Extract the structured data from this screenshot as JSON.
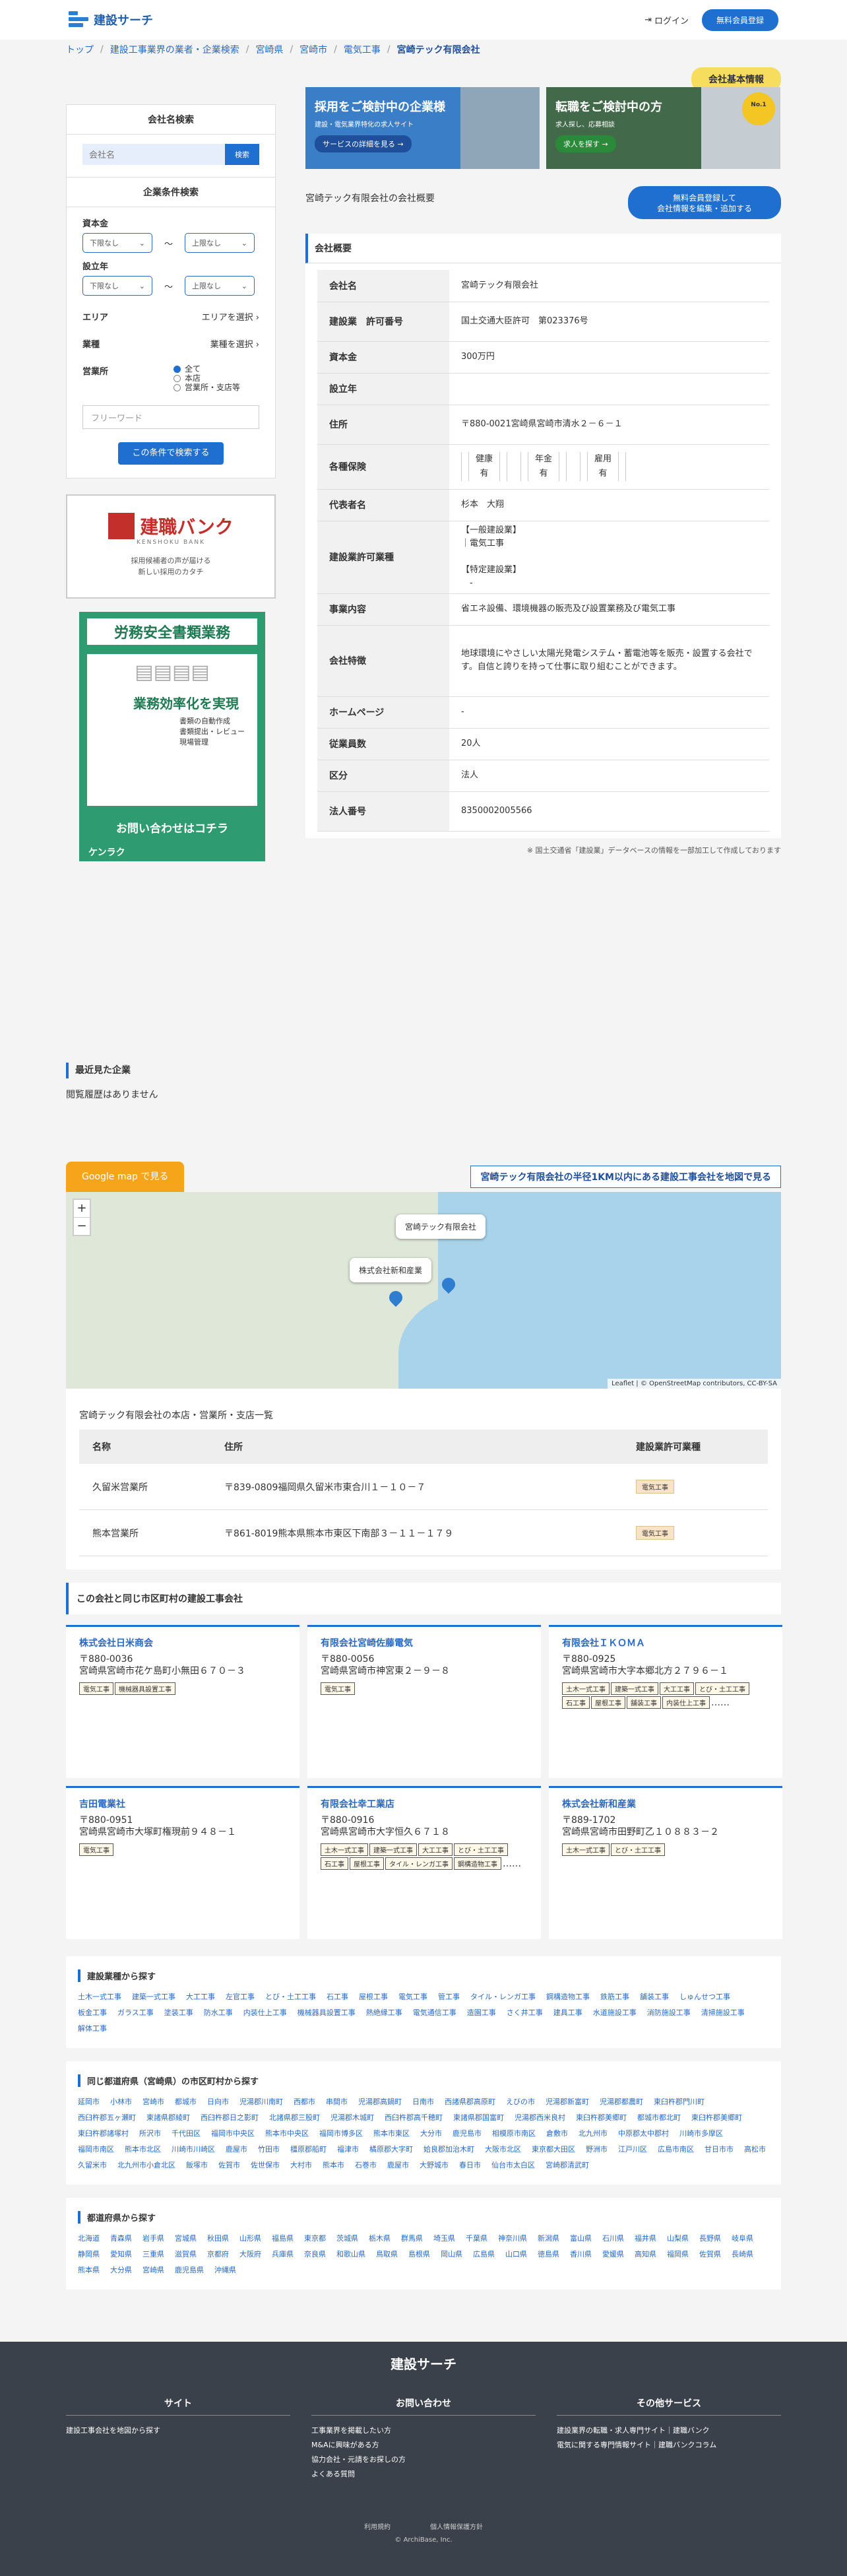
{
  "header": {
    "logo": "建設サーチ",
    "login": "ログイン",
    "register": "無料会員登録"
  },
  "breadcrumb": [
    "トップ",
    "建設工事業界の業者・企業検索",
    "宮崎県",
    "宮崎市",
    "電気工事",
    "宮崎テック有限会社"
  ],
  "badge": "会社基本情報",
  "sidebar": {
    "name_title": "会社名検索",
    "name_placeholder": "会社名",
    "name_btn": "検索",
    "cond_title": "企業条件検索",
    "capital": "資本金",
    "founded": "設立年",
    "lower": "下限なし",
    "upper": "上限なし",
    "tilde": "〜",
    "area": "エリア",
    "area_sel": "エリアを選択",
    "industry": "業種",
    "industry_sel": "業種を選択",
    "office": "営業所",
    "radios": [
      "全て",
      "本店",
      "営業所・支店等"
    ],
    "freeword": "フリーワード",
    "search_btn": "この条件で検索する",
    "bank_logo": "建職バンク",
    "bank_sub": "KENSHOKU BANK",
    "bank_msg1": "採用候補者の声が届ける",
    "bank_msg2": "新しい採用のカタチ",
    "ad_title": "労務安全書類業務",
    "ad_sub": "業務効率化を実現",
    "ad_items": [
      "書類の自動作成",
      "書類提出・レビュー",
      "現場管理"
    ],
    "ad_cta": "お問い合わせはコチラ",
    "ad_brand": "ケンラク"
  },
  "banners": [
    {
      "h": "採用をご検討中の企業様",
      "d": "建設・電気業界特化の求人サイト",
      "b": "サービスの詳細を見る →"
    },
    {
      "h": "転職をご検討中の方",
      "d": "求人探し、応募相談",
      "b": "求人を探す →",
      "medal": "No.1"
    }
  ],
  "overview": {
    "title": "宮崎テック有限会社の会社概要",
    "add1": "無料会員登録して",
    "add2": "会社情報を編集・追加する",
    "section": "会社概要"
  },
  "info": [
    {
      "k": "会社名",
      "v": "宮崎テック有限会社"
    },
    {
      "k": "建設業　許可番号",
      "v": "国土交通大臣許可　第023376号"
    },
    {
      "k": "資本金",
      "v": "300万円"
    },
    {
      "k": "設立年",
      "v": ""
    },
    {
      "k": "住所",
      "v": "〒880-0021宮崎県宮崎市清水２－６－１"
    },
    {
      "k": "各種保険",
      "ins": [
        [
          "健康",
          "有"
        ],
        [
          "年金",
          "有"
        ],
        [
          "雇用",
          "有"
        ]
      ]
    },
    {
      "k": "代表者名",
      "v": "杉本　大翔"
    },
    {
      "k": "建設業許可業種",
      "v": "【一般建設業】\n｜電気工事\n\n【特定建設業】\n　-"
    },
    {
      "k": "事業内容",
      "v": "省エネ設備、環境機器の販売及び設置業務及び電気工事"
    },
    {
      "k": "会社特徴",
      "v": "地球環境にやさしい太陽光発電システム・蓄電池等を販売・設置する会社です。自信と誇りを持って仕事に取り組むことができます。"
    },
    {
      "k": "ホームページ",
      "v": "-"
    },
    {
      "k": "従業員数",
      "v": "20人"
    },
    {
      "k": "区分",
      "v": "法人"
    },
    {
      "k": "法人番号",
      "v": "8350002005566"
    }
  ],
  "note": "※ 国土交通省「建設業」データベースの情報を一部加工して作成しております",
  "recent": {
    "title": "最近見た企業",
    "empty": "閲覧履歴はありません"
  },
  "map": {
    "gbtn": "Google map で見る",
    "radius": "宮崎テック有限会社の半径1KM以内にある建設工事会社を地図で見る",
    "popup1": "宮崎テック有限会社",
    "popup2": "株式会社新和産業",
    "attribution": "Leaflet | © OpenStreetMap contributors, CC-BY-SA",
    "zoom_in": "+",
    "zoom_out": "−"
  },
  "branches": {
    "title": "宮崎テック有限会社の本店・営業所・支店一覧",
    "cols": [
      "名称",
      "住所",
      "建設業許可業種"
    ],
    "rows": [
      [
        "久留米営業所",
        "〒839-0809福岡県久留米市東合川１－１０－７",
        "電気工事"
      ],
      [
        "熊本営業所",
        "〒861-8019熊本県熊本市東区下南部３－１１－１７９",
        "電気工事"
      ]
    ]
  },
  "near": {
    "title": "この会社と同じ市区町村の建設工事会社",
    "cards": [
      {
        "n": "株式会社日米商会",
        "z": "〒880-0036",
        "a": "宮崎県宮崎市花ケ島町小無田６７０－３",
        "tags": [
          "電気工事",
          "機械器具設置工事"
        ]
      },
      {
        "n": "有限会社宮崎佐藤電気",
        "z": "〒880-0056",
        "a": "宮崎県宮崎市神宮東２－９－８",
        "tags": [
          "電気工事"
        ]
      },
      {
        "n": "有限会社ＩＫＯＭＡ",
        "z": "〒880-0925",
        "a": "宮崎県宮崎市大字本郷北方２７９６－１",
        "tags": [
          "土木一式工事",
          "建築一式工事",
          "大工工事",
          "とび・土工工事",
          "石工事",
          "屋根工事",
          "舗装工事",
          "内装仕上工事"
        ],
        "more": "……"
      },
      {
        "n": "吉田電業社",
        "z": "〒880-0951",
        "a": "宮崎県宮崎市大塚町権現前９４８－１",
        "tags": [
          "電気工事"
        ]
      },
      {
        "n": "有限会社幸工業店",
        "z": "〒880-0916",
        "a": "宮崎県宮崎市大字恒久６７１８",
        "tags": [
          "土木一式工事",
          "建築一式工事",
          "大工工事",
          "とび・土工工事",
          "石工事",
          "屋根工事",
          "タイル・レンガ工事",
          "鋼構造物工事"
        ],
        "more": "……"
      },
      {
        "n": "株式会社新和産業",
        "z": "〒889-1702",
        "a": "宮崎県宮崎市田野町乙１０８８３－２",
        "tags": [
          "土木一式工事",
          "とび・土工工事"
        ]
      }
    ]
  },
  "industries": {
    "title": "建設業種から探す",
    "items": [
      "土木一式工事",
      "建築一式工事",
      "大工工事",
      "左官工事",
      "とび・土工工事",
      "石工事",
      "屋根工事",
      "電気工事",
      "管工事",
      "タイル・レンガ工事",
      "鋼構造物工事",
      "鉄筋工事",
      "舗装工事",
      "しゅんせつ工事",
      "板金工事",
      "ガラス工事",
      "塗装工事",
      "防水工事",
      "内装仕上工事",
      "機械器具設置工事",
      "熱絶縁工事",
      "電気通信工事",
      "造園工事",
      "さく井工事",
      "建具工事",
      "水道施設工事",
      "消防施設工事",
      "清掃施設工事",
      "解体工事"
    ]
  },
  "cities": {
    "title": "同じ都道府県（宮崎県）の市区町村から探す",
    "items": [
      "延岡市",
      "小林市",
      "宮崎市",
      "都城市",
      "日向市",
      "児湯郡川南町",
      "西都市",
      "串間市",
      "児湯郡高鍋町",
      "日南市",
      "西諸県郡高原町",
      "えびの市",
      "児湯郡新富町",
      "児湯郡都農町",
      "東臼杵郡門川町",
      "西臼杵郡五ヶ瀬町",
      "東諸県郡綾町",
      "西臼杵郡日之影町",
      "北諸県郡三股町",
      "児湯郡木城町",
      "西臼杵郡高千穂町",
      "東諸県郡国富町",
      "児湯郡西米良村",
      "東臼杵郡美郷町",
      "都城市都北町",
      "東臼杵郡美郷町",
      "東臼杵郡諸塚村",
      "所沢市",
      "千代田区",
      "福岡市中央区",
      "熊本市中央区",
      "福岡市博多区",
      "熊本市東区",
      "大分市",
      "鹿児島市",
      "相模原市南区",
      "倉敷市",
      "北九州市",
      "中原郡太中郡村",
      "川崎市多摩区",
      "福岡市南区",
      "熊本市北区",
      "川崎市川崎区",
      "鹿屋市",
      "竹田市",
      "橿原郡船町",
      "福津市",
      "橘原郡大字町",
      "姶良郡加治木町",
      "大阪市北区",
      "東京都大田区",
      "野洲市",
      "江戸川区",
      "広島市南区",
      "甘日市市",
      "高松市",
      "久留米市",
      "北九州市小倉北区",
      "飯塚市",
      "佐賀市",
      "佐世保市",
      "大村市",
      "熊本市",
      "石巻市",
      "鹿屋市",
      "大野城市",
      "春日市",
      "仙台市太白区",
      "宮崎郡清武町"
    ]
  },
  "prefs": {
    "title": "都道府県から探す",
    "items": [
      "北海道",
      "青森県",
      "岩手県",
      "宮城県",
      "秋田県",
      "山形県",
      "福島県",
      "東京都",
      "茨城県",
      "栃木県",
      "群馬県",
      "埼玉県",
      "千葉県",
      "神奈川県",
      "新潟県",
      "富山県",
      "石川県",
      "福井県",
      "山梨県",
      "長野県",
      "岐阜県",
      "静岡県",
      "愛知県",
      "三重県",
      "滋賀県",
      "京都府",
      "大阪府",
      "兵庫県",
      "奈良県",
      "和歌山県",
      "鳥取県",
      "島根県",
      "岡山県",
      "広島県",
      "山口県",
      "徳島県",
      "香川県",
      "愛媛県",
      "高知県",
      "福岡県",
      "佐賀県",
      "長崎県",
      "熊本県",
      "大分県",
      "宮崎県",
      "鹿児島県",
      "沖縄県"
    ]
  },
  "footer": {
    "title": "建設サーチ",
    "cols": [
      {
        "h": "サイト",
        "items": [
          "建設工事会社を地図から探す"
        ]
      },
      {
        "h": "お問い合わせ",
        "items": [
          "工事業界を掲載したい方",
          "M&Aに興味がある方",
          "協力会社・元請をお探しの方",
          "よくある質問"
        ]
      },
      {
        "h": "その他サービス",
        "items": [
          "建設業界の転職・求人専門サイト｜建職バンク",
          "電気に関する専門情報サイト｜建職バンクコラム"
        ]
      }
    ],
    "links": [
      "利用規約",
      "個人情報保護方針"
    ],
    "copy": "© ArchiBase, Inc."
  }
}
